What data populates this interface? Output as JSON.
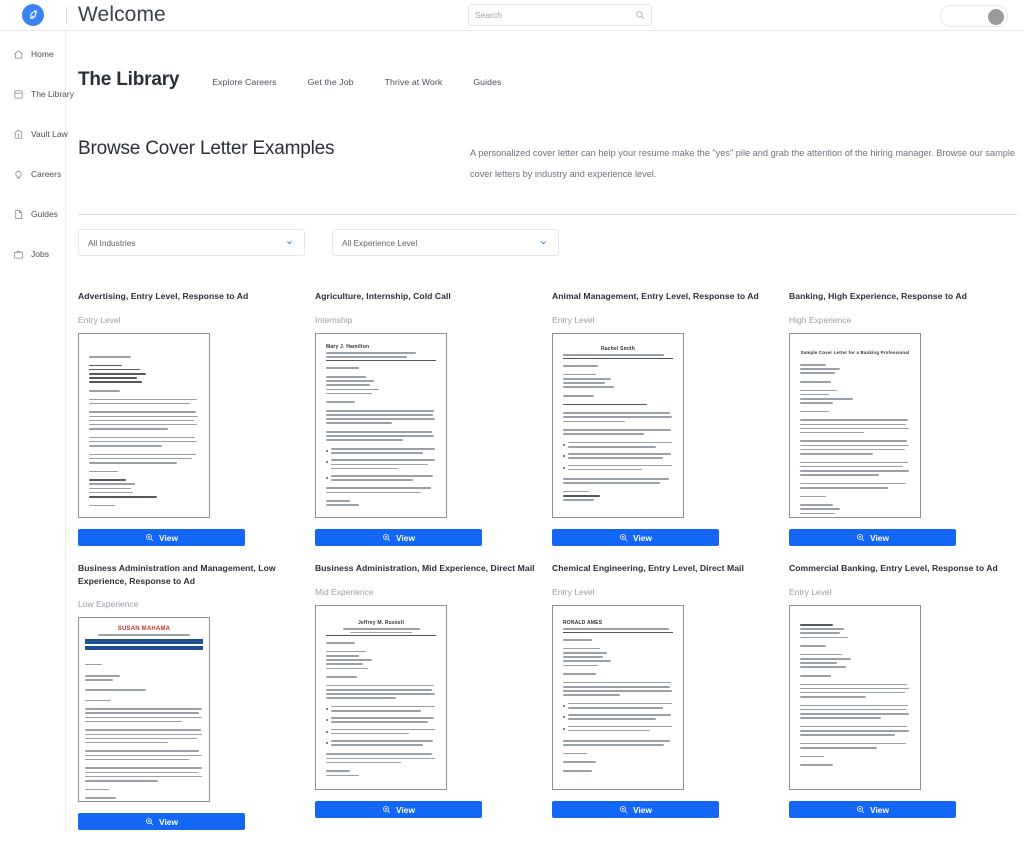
{
  "topbar": {
    "app_title": "Welcome",
    "logo_icon": "feather-logo-icon",
    "search": {
      "value": "",
      "placeholder": "Search",
      "icon": "search-icon"
    },
    "theme_toggle": {
      "state": "off",
      "icon": "toggle-switch-icon"
    }
  },
  "sidebar": {
    "items": [
      {
        "label": "Home",
        "icon": "home-icon"
      },
      {
        "label": "The Library",
        "icon": "book-icon"
      },
      {
        "label": "Vault Law",
        "icon": "bank-icon"
      },
      {
        "label": "Careers",
        "icon": "lightbulb-icon"
      },
      {
        "label": "Guides",
        "icon": "document-icon"
      },
      {
        "label": "Jobs",
        "icon": "briefcase-icon"
      }
    ]
  },
  "page": {
    "title": "The Library",
    "subnav": [
      {
        "label": "Explore Careers"
      },
      {
        "label": "Get the Job"
      },
      {
        "label": "Thrive at Work"
      },
      {
        "label": "Guides"
      }
    ],
    "heading": "Browse Cover Letter Examples",
    "description": "A personalized cover letter can help your resume make the \"yes\" pile and grab the attention of the hiring manager. Browse our sample cover letters by industry and experience level."
  },
  "filters": [
    {
      "name": "industry",
      "value": "All Industries",
      "icon": "chevron-down-icon"
    },
    {
      "name": "experience",
      "value": "All Experience Level",
      "icon": "chevron-down-icon"
    }
  ],
  "button_labels": {
    "view": "View",
    "view_icon": "zoom-in-icon"
  },
  "colors": {
    "accent": "#1466f5",
    "logo": "#3b82f6",
    "muted_text": "#989ea6"
  },
  "cards": [
    {
      "title": "Advertising, Entry Level, Response to Ad",
      "level": "Entry Level",
      "style": "plain",
      "view_label": "View"
    },
    {
      "title": "Agriculture, Internship, Cold Call",
      "level": "Internship",
      "style": "named-header",
      "header_name": "Mary J. Hamilton",
      "view_label": "View"
    },
    {
      "title": "Animal Management, Entry Level, Response to Ad",
      "level": "Entry Level",
      "style": "centered-header",
      "header_name": "Rachel Smith",
      "view_label": "View"
    },
    {
      "title": "Banking, High Experience, Response to Ad",
      "level": "High Experience",
      "style": "centered-title",
      "header_name": "Sample Cover Letter for a Banking Professional",
      "view_label": "View"
    },
    {
      "title": "Business Administration and Management, Low Experience, Response to Ad",
      "level": "Low Experience",
      "style": "banner",
      "header_name": "SUSAN MAHAMA",
      "view_label": "View"
    },
    {
      "title": "Business Administration, Mid Experience, Direct Mail",
      "level": "Mid Experience",
      "style": "named-header",
      "header_name": "Jeffrey M. Russell",
      "view_label": "View"
    },
    {
      "title": "Chemical Engineering, Entry Level, Direct Mail",
      "level": "Entry Level",
      "style": "named-header",
      "header_name": "RONALD AMES",
      "view_label": "View"
    },
    {
      "title": "Commercial Banking, Entry Level, Response to Ad",
      "level": "Entry Level",
      "style": "plain",
      "view_label": "View"
    }
  ]
}
